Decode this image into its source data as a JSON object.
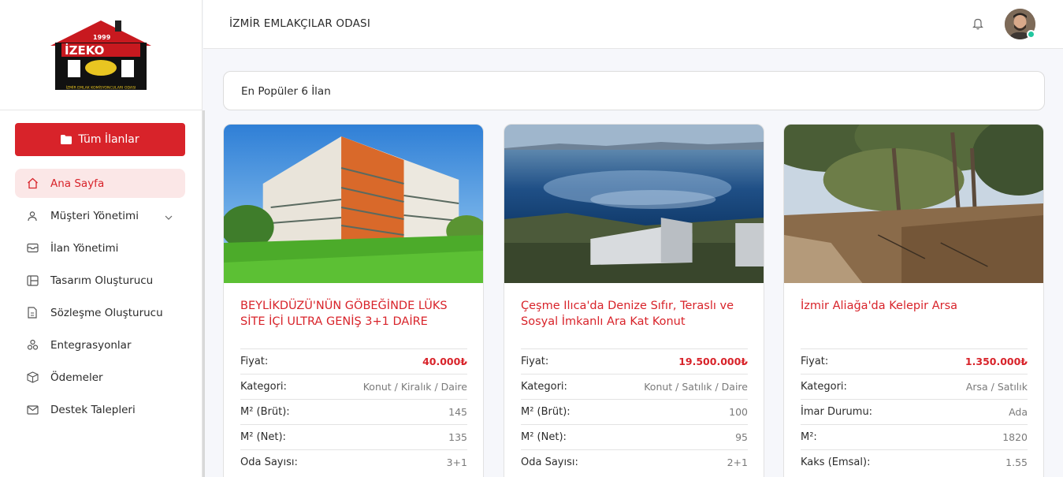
{
  "logo": {
    "year": "1999",
    "brand": "İZEKO",
    "tagline": "İZMİR EMLAK KOMİSYONCULARI ODASI"
  },
  "sidebar": {
    "primary_button": "Tüm İlanlar",
    "items": [
      {
        "label": "Ana Sayfa",
        "icon": "home-icon",
        "active": true
      },
      {
        "label": "Müşteri Yönetimi",
        "icon": "user-icon",
        "has_submenu": true
      },
      {
        "label": "İlan Yönetimi",
        "icon": "inbox-icon"
      },
      {
        "label": "Tasarım Oluşturucu",
        "icon": "layout-icon"
      },
      {
        "label": "Sözleşme Oluşturucu",
        "icon": "document-icon"
      },
      {
        "label": "Entegrasyonlar",
        "icon": "integrations-icon"
      },
      {
        "label": "Ödemeler",
        "icon": "box-icon"
      },
      {
        "label": "Destek Talepleri",
        "icon": "mail-icon"
      }
    ]
  },
  "header": {
    "title": "İZMİR EMLAKÇILAR ODASI"
  },
  "section": {
    "title": "En Popüler 6 İlan"
  },
  "listings": [
    {
      "title": "BEYLİKDÜZÜ'NÜN GÖBEĞİNDE LÜKS SİTE İÇİ ULTRA GENİŞ 3+1 DAİRE",
      "image": "apartment-building-photo",
      "specs": [
        {
          "label": "Fiyat:",
          "value": "40.000₺",
          "price": true
        },
        {
          "label": "Kategori:",
          "value": "Konut / Kiralık / Daire"
        },
        {
          "label": "M² (Brüt):",
          "value": "145"
        },
        {
          "label": "M² (Net):",
          "value": "135"
        },
        {
          "label": "Oda Sayısı:",
          "value": "3+1"
        }
      ]
    },
    {
      "title": "Çeşme Ilıca'da Denize Sıfır, Teraslı ve Sosyal İmkanlı Ara Kat Konut",
      "image": "seaside-building-photo",
      "specs": [
        {
          "label": "Fiyat:",
          "value": "19.500.000₺",
          "price": true
        },
        {
          "label": "Kategori:",
          "value": "Konut / Satılık / Daire"
        },
        {
          "label": "M² (Brüt):",
          "value": "100"
        },
        {
          "label": "M² (Net):",
          "value": "95"
        },
        {
          "label": "Oda Sayısı:",
          "value": "2+1"
        }
      ]
    },
    {
      "title": "İzmir Aliağa'da Kelepir Arsa",
      "image": "land-plot-photo",
      "specs": [
        {
          "label": "Fiyat:",
          "value": "1.350.000₺",
          "price": true
        },
        {
          "label": "Kategori:",
          "value": "Arsa / Satılık"
        },
        {
          "label": "İmar Durumu:",
          "value": "Ada"
        },
        {
          "label": "M²:",
          "value": "1820"
        },
        {
          "label": "Kaks (Emsal):",
          "value": "1.55"
        }
      ]
    }
  ],
  "colors": {
    "accent": "#d8232a",
    "accent_soft": "#fbe7e7",
    "online": "#22c7a0"
  }
}
